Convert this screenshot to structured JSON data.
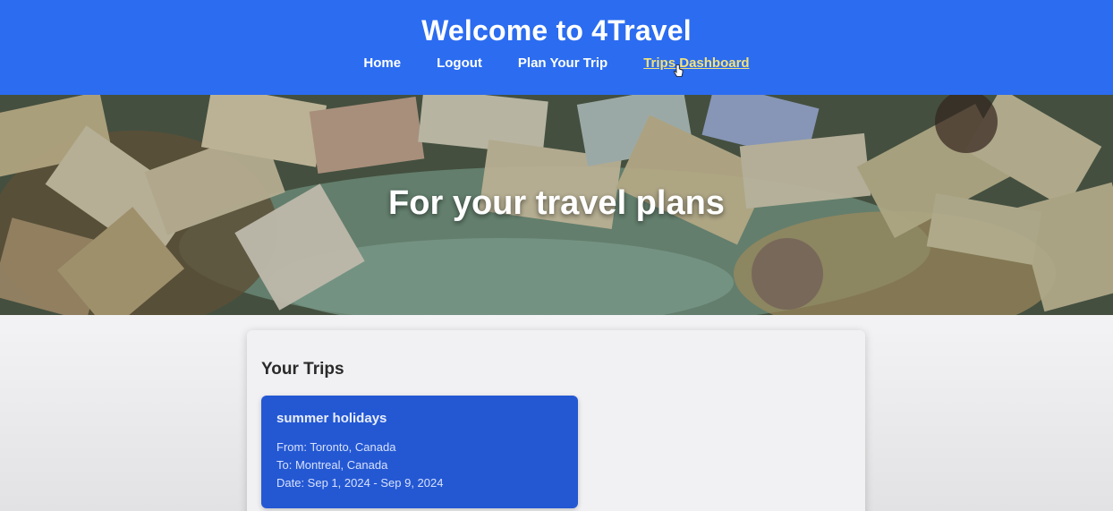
{
  "header": {
    "title": "Welcome to 4Travel",
    "nav": [
      {
        "label": "Home"
      },
      {
        "label": "Logout"
      },
      {
        "label": "Plan Your Trip"
      },
      {
        "label": "Trips Dashboard",
        "active": true
      }
    ]
  },
  "hero": {
    "title": "For your travel plans"
  },
  "trips": {
    "heading": "Your Trips",
    "items": [
      {
        "name": "summer holidays",
        "from": "From: Toronto, Canada",
        "to": "To: Montreal, Canada",
        "date": "Date: Sep 1, 2024 - Sep 9, 2024"
      }
    ]
  },
  "colors": {
    "header_bg": "#2b6cf0",
    "active_nav": "#f3e27a",
    "card_bg": "#2458d3"
  }
}
